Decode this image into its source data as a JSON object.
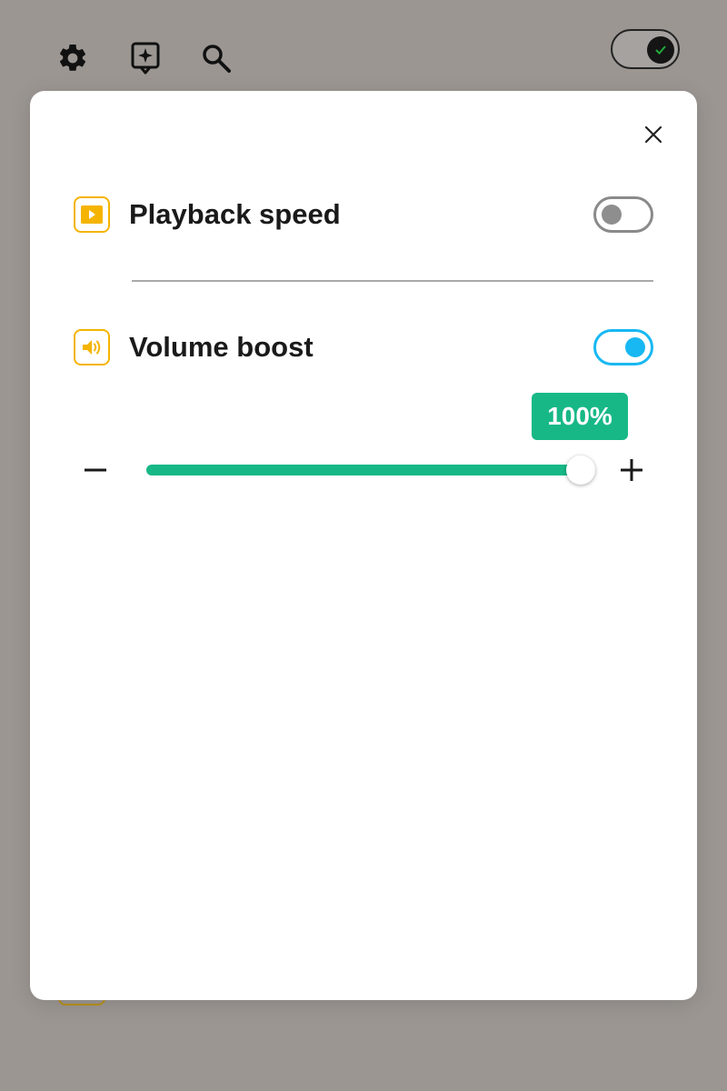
{
  "toolbar": {
    "icons": [
      "gear-icon",
      "feedback-icon",
      "search-icon"
    ],
    "theme_toggle_on": true
  },
  "dialog": {
    "close_icon": "close-icon",
    "rows": [
      {
        "label": "Playback speed",
        "icon": "play-icon",
        "enabled": false
      },
      {
        "label": "Volume boost",
        "icon": "speaker-icon",
        "enabled": true
      }
    ],
    "volume": {
      "value_label": "100%",
      "fraction": 1.0,
      "decrement_icon": "minus-icon",
      "increment_icon": "plus-icon"
    }
  },
  "colors": {
    "backdrop": "#9b9692",
    "icon_accent": "#f5b400",
    "toggle_on": "#18b8f2",
    "toggle_off": "#8a8a8a",
    "slider": "#17b886"
  }
}
